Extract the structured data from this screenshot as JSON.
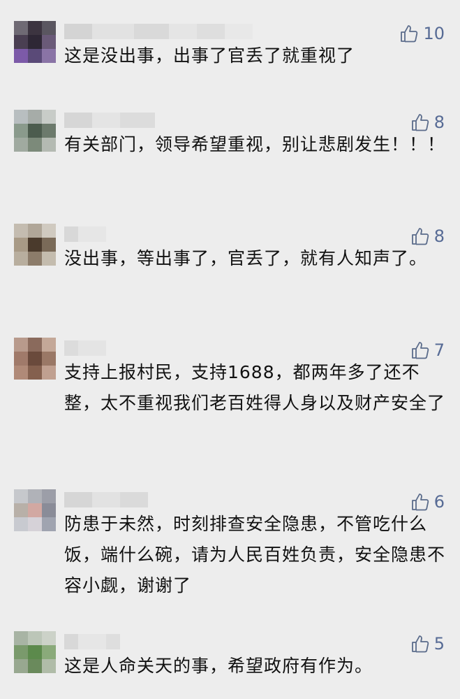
{
  "comments": [
    {
      "likes": "10",
      "text": "这是没出事，出事了官丢了就重视了"
    },
    {
      "likes": "8",
      "text": "有关部门，领导希望重视，别让悲剧发生！！！"
    },
    {
      "likes": "8",
      "text": "没出事，等出事了，官丢了，就有人知声了。"
    },
    {
      "likes": "7",
      "text": "支持上报村民，支持1688，都两年多了还不整，太不重视我们老百姓得人身以及财产安全了"
    },
    {
      "likes": "6",
      "text": "防患于未然，时刻排查安全隐患，不管吃什么饭，端什么碗，请为人民百姓负责，安全隐患不容小觑，谢谢了"
    },
    {
      "likes": "5",
      "text": "这是人命关天的事，希望政府有作为。"
    }
  ],
  "icons": {
    "like": "thumbs-up-icon"
  },
  "colors": {
    "background": "#ededed",
    "like_count": "#576b95",
    "text": "#111111"
  }
}
